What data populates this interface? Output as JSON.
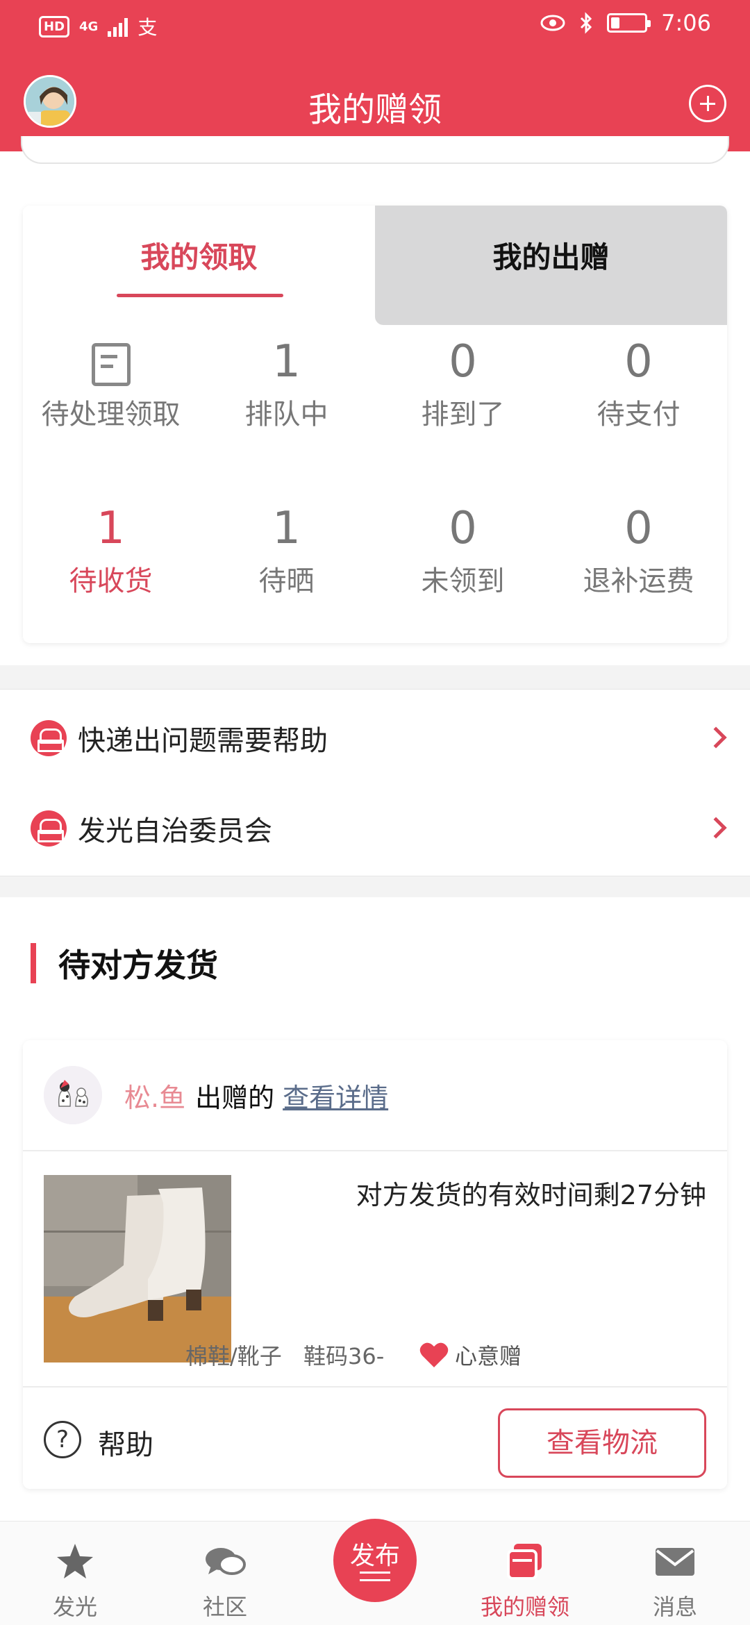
{
  "status_bar": {
    "time": "7:06",
    "hd": "HD",
    "network": "4G",
    "pay_glyph": "支",
    "battery_level": 0.25,
    "icons": [
      "eye-icon",
      "bluetooth-icon",
      "battery-icon"
    ]
  },
  "header": {
    "title": "我的赠领",
    "colors": {
      "brand": "#e84254"
    }
  },
  "tabs": [
    {
      "label": "我的领取",
      "active": true
    },
    {
      "label": "我的出赠",
      "active": false
    }
  ],
  "stats": [
    {
      "value": "",
      "label": "待处理领取",
      "icon": "document-clock-icon"
    },
    {
      "value": "1",
      "label": "排队中"
    },
    {
      "value": "0",
      "label": "排到了"
    },
    {
      "value": "0",
      "label": "待支付"
    },
    {
      "value": "1",
      "label": "待收货"
    },
    {
      "value": "1",
      "label": "待晒"
    },
    {
      "value": "0",
      "label": "未领到"
    },
    {
      "value": "0",
      "label": "退补运费"
    }
  ],
  "help_links": [
    {
      "label": "快递出问题需要帮助",
      "icon": "help-icon"
    },
    {
      "label": "发光自治委员会",
      "icon": "help-icon"
    }
  ],
  "pending": {
    "section_title": "待对方发货",
    "order": {
      "giver_name": "松.鱼",
      "giver_suffix": "出赠的",
      "detail_link": "查看详情",
      "countdown": "对方发货的有效时间剩27分钟",
      "category": "棉鞋/靴子",
      "size": "鞋码36-",
      "type_label": "心意赠",
      "help_label": "帮助",
      "logistics_button": "查看物流"
    }
  },
  "bottom_nav": [
    {
      "label": "发光",
      "icon": "star-icon"
    },
    {
      "label": "社区",
      "icon": "chat-bubbles-icon"
    },
    {
      "label": "发布",
      "icon": "publish-icon"
    },
    {
      "label": "我的赠领",
      "icon": "gift-box-icon",
      "active": true
    },
    {
      "label": "消息",
      "icon": "mail-icon"
    }
  ]
}
